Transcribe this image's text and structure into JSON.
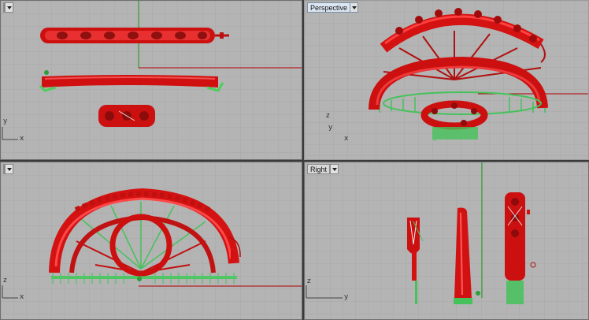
{
  "viewports": {
    "top": {
      "label": "",
      "axes": [
        "y",
        "x"
      ]
    },
    "perspective": {
      "label": "Perspective",
      "axes": [
        "z",
        "y",
        "x"
      ]
    },
    "front": {
      "label": "",
      "axes": [
        "z",
        "x"
      ]
    },
    "right": {
      "label": "Right",
      "axes": [
        "z",
        "y"
      ]
    }
  },
  "colors": {
    "viewport_bg": "#b4b4b4",
    "grid": "#a6a6a6",
    "object": "#dd1010",
    "supports": "#3cc050",
    "x_axis": "#c00000",
    "y_axis": "#00a000"
  },
  "icons": [
    "viewport-menu-icon"
  ]
}
